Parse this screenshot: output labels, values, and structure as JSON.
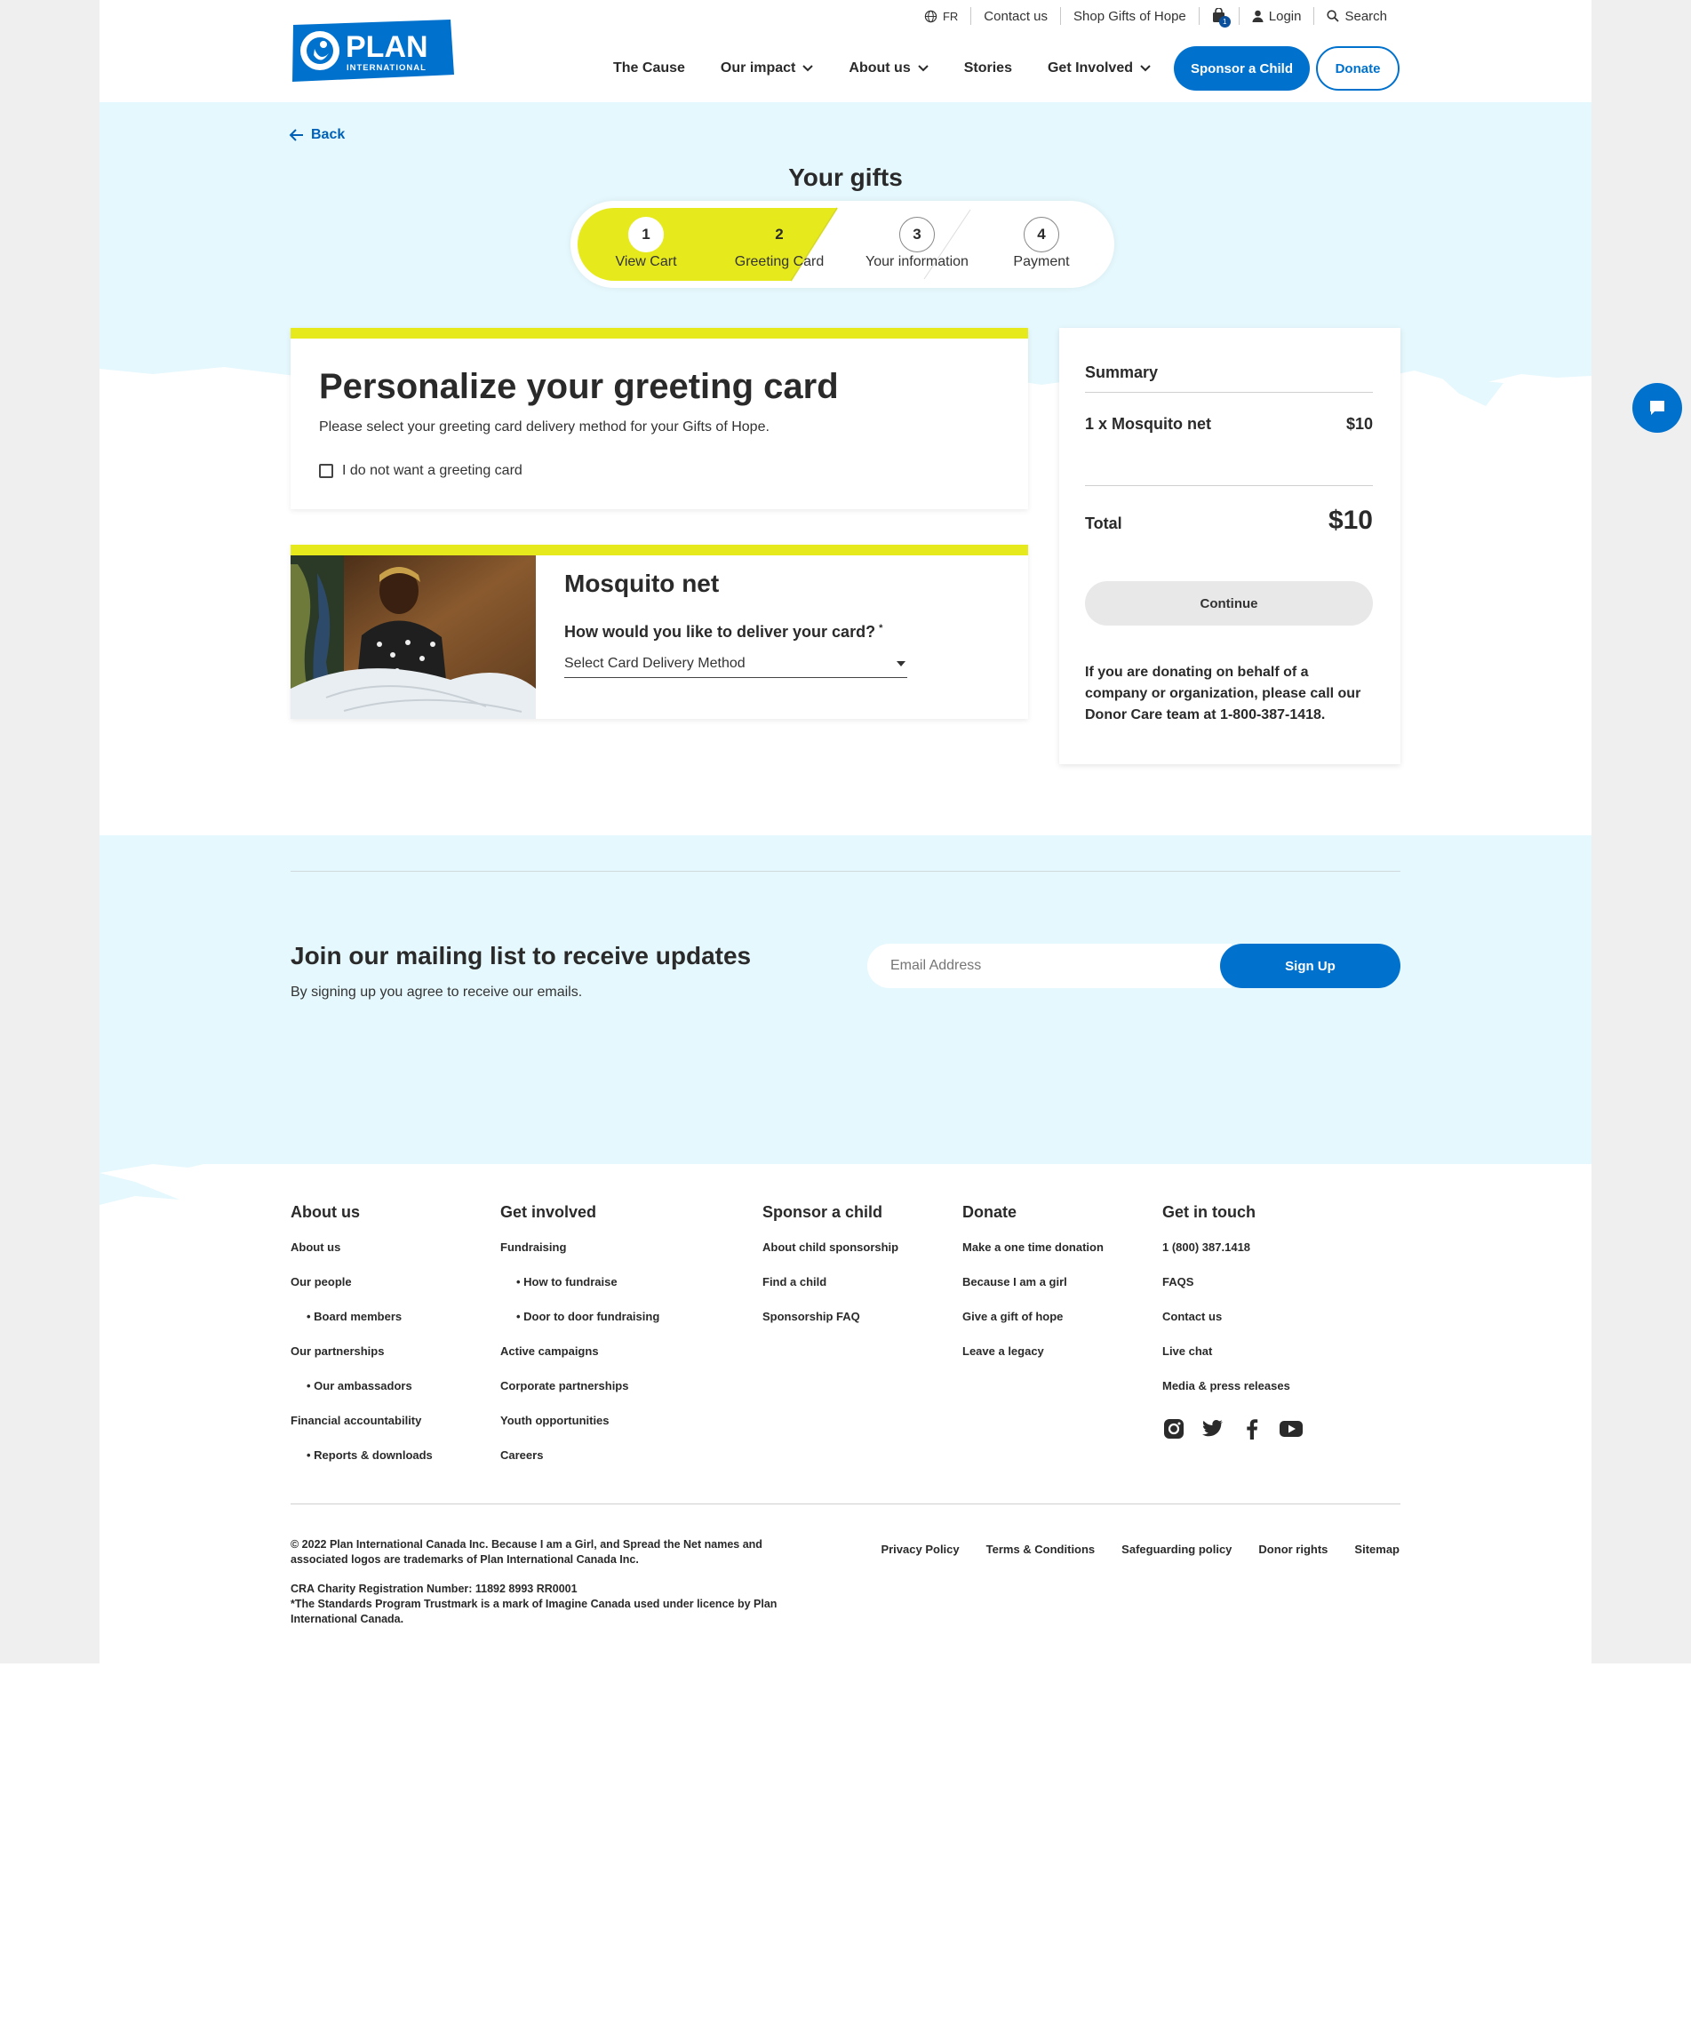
{
  "utility": {
    "language": "FR",
    "contact": "Contact us",
    "shop": "Shop Gifts of Hope",
    "cart_count": "1",
    "login": "Login",
    "search": "Search"
  },
  "nav": {
    "items": [
      {
        "label": "The Cause",
        "dropdown": false
      },
      {
        "label": "Our impact",
        "dropdown": true
      },
      {
        "label": "About us",
        "dropdown": true
      },
      {
        "label": "Stories",
        "dropdown": false
      },
      {
        "label": "Get Involved",
        "dropdown": true
      }
    ],
    "sponsor": "Sponsor a Child",
    "donate": "Donate"
  },
  "logo": {
    "main": "PLAN",
    "sub": "INTERNATIONAL"
  },
  "checkout": {
    "back": "Back",
    "title": "Your gifts",
    "steps": [
      {
        "num": "1",
        "label": "View Cart",
        "state": "done"
      },
      {
        "num": "2",
        "label": "Greeting Card",
        "state": "active"
      },
      {
        "num": "3",
        "label": "Your information",
        "state": "pending"
      },
      {
        "num": "4",
        "label": "Payment",
        "state": "pending"
      }
    ]
  },
  "greeting": {
    "heading": "Personalize your greeting card",
    "intro": "Please select your greeting card delivery method for your Gifts of Hope.",
    "no_card_label": "I do not want a greeting card"
  },
  "gift": {
    "name": "Mosquito net",
    "question": "How would you like to deliver your card?",
    "required_mark": "*",
    "select_placeholder": "Select Card Delivery Method"
  },
  "summary": {
    "title": "Summary",
    "item": "1 x Mosquito net",
    "item_price": "$10",
    "total_label": "Total",
    "total_value": "$10",
    "continue": "Continue",
    "note": "If you are donating on behalf of a company or organization, please call our Donor Care team at 1-800-387-1418."
  },
  "mailing": {
    "heading": "Join our mailing list to receive updates",
    "sub": "By signing up you agree to receive our emails.",
    "email_placeholder": "Email Address",
    "signup": "Sign Up"
  },
  "footer": {
    "about": {
      "heading": "About us",
      "links": [
        "About us",
        "Our people",
        "• Board members",
        "Our partnerships",
        "• Our ambassadors",
        "Financial accountability",
        "• Reports & downloads"
      ]
    },
    "involved": {
      "heading": "Get involved",
      "links": [
        "Fundraising",
        "• How to fundraise",
        "• Door to door fundraising",
        "Active campaigns",
        "Corporate partnerships",
        "Youth opportunities",
        "Careers"
      ]
    },
    "sponsor": {
      "heading": "Sponsor a child",
      "links": [
        "About child sponsorship",
        "Find a child",
        "Sponsorship FAQ"
      ]
    },
    "donate": {
      "heading": "Donate",
      "links": [
        "Make a one time donation",
        "Because I am a girl",
        "Give a gift of hope",
        "Leave a legacy"
      ]
    },
    "contact": {
      "heading": "Get in touch",
      "links": [
        "1 (800) 387.1418",
        "FAQS",
        "Contact us",
        "Live chat",
        "Media & press releases"
      ]
    },
    "social": [
      "instagram-icon",
      "twitter-icon",
      "facebook-icon",
      "youtube-icon"
    ],
    "copyright": "© 2022 Plan International Canada Inc. Because I am a Girl, and Spread the Net names and associated logos are trademarks of Plan International Canada Inc.",
    "cra": "CRA Charity Registration Number: 11892 8993 RR0001",
    "trustmark": "*The Standards Program Trustmark is a mark of Imagine Canada used under licence by Plan International Canada.",
    "policies": [
      "Privacy Policy",
      "Terms & Conditions",
      "Safeguarding policy",
      "Donor rights",
      "Sitemap"
    ]
  },
  "colors": {
    "brand_blue": "#0072ce",
    "accent_yellow": "#e6e91b",
    "band_blue": "#e5f8fd"
  }
}
